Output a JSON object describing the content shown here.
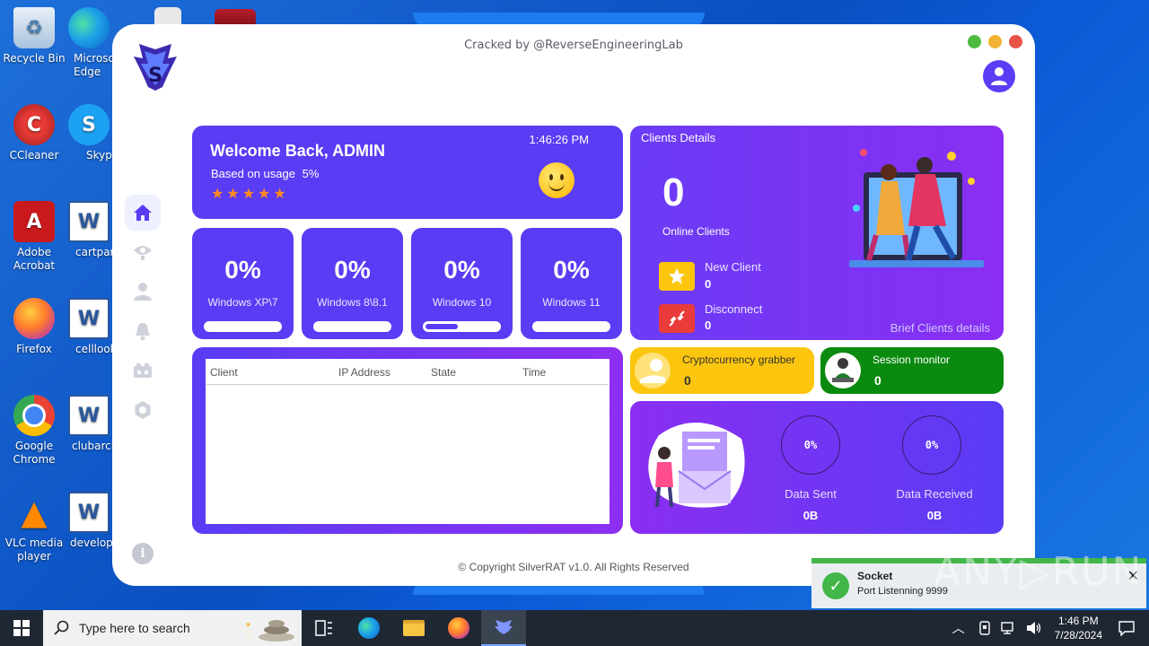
{
  "desktop": {
    "icons": [
      {
        "label": "Recycle Bin",
        "glyph": "♻"
      },
      {
        "label": "Microsoft Edge",
        "glyph": ""
      },
      {
        "label": "CCleaner",
        "glyph": "C"
      },
      {
        "label": "Skype",
        "glyph": "S"
      },
      {
        "label": "Adobe Acrobat",
        "glyph": "A"
      },
      {
        "label": "cartpart.rtf",
        "glyph": "W"
      },
      {
        "label": "Firefox",
        "glyph": ""
      },
      {
        "label": "celllook.rtf",
        "glyph": "W"
      },
      {
        "label": "Google Chrome",
        "glyph": ""
      },
      {
        "label": "clubarch.rtf",
        "glyph": "W"
      },
      {
        "label": "VLC media player",
        "glyph": "▲"
      },
      {
        "label": "developm...",
        "glyph": "W"
      }
    ]
  },
  "app": {
    "title": "Cracked by @ReverseEngineeringLab",
    "window_dot_colors": [
      "#4cbb3f",
      "#f2b233",
      "#e8534a"
    ],
    "accent": "#5a3cf4",
    "sidebar": [
      {
        "name": "home",
        "icon": "home-icon"
      },
      {
        "name": "monitor",
        "icon": "eye-icon"
      },
      {
        "name": "users",
        "icon": "user-icon"
      },
      {
        "name": "notifications",
        "icon": "bell-icon"
      },
      {
        "name": "builder",
        "icon": "box-icon"
      },
      {
        "name": "settings",
        "icon": "gear-icon"
      }
    ],
    "info_glyph": "i",
    "welcome": {
      "title": "Welcome Back, ADMIN",
      "usage_label": "Based on usage",
      "usage_value": "5%",
      "stars": "★★★★★",
      "time": "1:46:26 PM"
    },
    "os_stats": [
      {
        "pct": "0%",
        "name": "Windows XP\\7",
        "fill": 0
      },
      {
        "pct": "0%",
        "name": "Windows 8\\8.1",
        "fill": 0
      },
      {
        "pct": "0%",
        "name": "Windows 10",
        "fill": 0.45
      },
      {
        "pct": "0%",
        "name": "Windows 11",
        "fill": 0
      }
    ],
    "client_table": {
      "columns": [
        "Client",
        "IP Address",
        "State",
        "Time"
      ]
    },
    "clients": {
      "header": "Clients Details",
      "online_count": "0",
      "online_label": "Online Clients",
      "new_label": "New Client",
      "new_value": "0",
      "disconnect_label": "Disconnect",
      "disconnect_value": "0",
      "brief": "Brief Clients details"
    },
    "crypto": {
      "label": "Cryptocurrency grabber",
      "value": "0"
    },
    "session": {
      "label": "Session monitor",
      "value": "0"
    },
    "data": {
      "sent_pct": "0%",
      "sent_label": "Data Sent",
      "sent_value": "0B",
      "recv_pct": "0%",
      "recv_label": "Data Received",
      "recv_value": "0B"
    },
    "copyright": "© Copyright SilverRAT v1.0. All Rights Reserved"
  },
  "toast": {
    "title": "Socket",
    "message": "Port Listenning 9999",
    "close": "✕"
  },
  "watermark": "ANY▷RUN",
  "taskbar": {
    "search_placeholder": "Type here to search",
    "time": "1:46 PM",
    "date": "7/28/2024"
  }
}
